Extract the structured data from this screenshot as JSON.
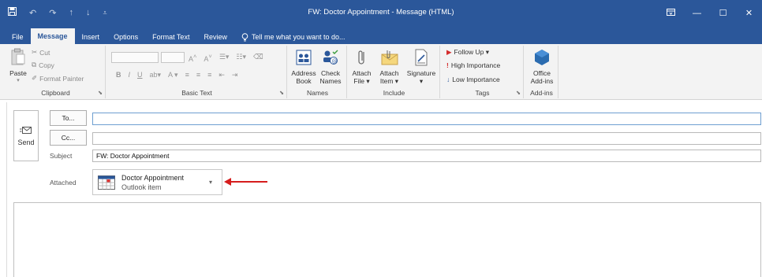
{
  "window": {
    "title": "FW: Doctor Appointment - Message (HTML)",
    "controls": {
      "restore": "▢▭",
      "minimize": "—",
      "maximize": "☐",
      "close": "✕"
    }
  },
  "qat": {
    "save": "🖫",
    "undo": "↶",
    "redo": "↷",
    "up": "↑",
    "down": "↓",
    "customize": "⯆"
  },
  "tabs": [
    "File",
    "Message",
    "Insert",
    "Options",
    "Format Text",
    "Review"
  ],
  "active_tab": "Message",
  "tell_me": "Tell me what you want to do...",
  "ribbon": {
    "clipboard": {
      "label": "Clipboard",
      "paste": "Paste",
      "cut": "Cut",
      "copy": "Copy",
      "format_painter": "Format Painter"
    },
    "basic_text": {
      "label": "Basic Text",
      "bold": "B",
      "italic": "I",
      "underline": "U"
    },
    "names": {
      "label": "Names",
      "address_book_1": "Address",
      "address_book_2": "Book",
      "check_names_1": "Check",
      "check_names_2": "Names"
    },
    "include": {
      "label": "Include",
      "attach_file_1": "Attach",
      "attach_file_2": "File ▾",
      "attach_item_1": "Attach",
      "attach_item_2": "Item ▾",
      "signature_1": "Signature",
      "signature_2": "▾"
    },
    "tags": {
      "label": "Tags",
      "follow_up": "Follow Up ▾",
      "high_importance": "High Importance",
      "low_importance": "Low Importance"
    },
    "addins": {
      "label": "Add-ins",
      "office_addins_1": "Office",
      "office_addins_2": "Add-ins"
    }
  },
  "compose": {
    "send": "Send",
    "to_button": "To...",
    "cc_button": "Cc...",
    "to_value": "",
    "cc_value": "",
    "subject_label": "Subject",
    "subject_value": "FW: Doctor Appointment",
    "attached_label": "Attached",
    "attachment": {
      "name": "Doctor Appointment",
      "type": "Outlook item"
    }
  },
  "colors": {
    "brand": "#2b579a",
    "arrow": "#d61d1d"
  }
}
